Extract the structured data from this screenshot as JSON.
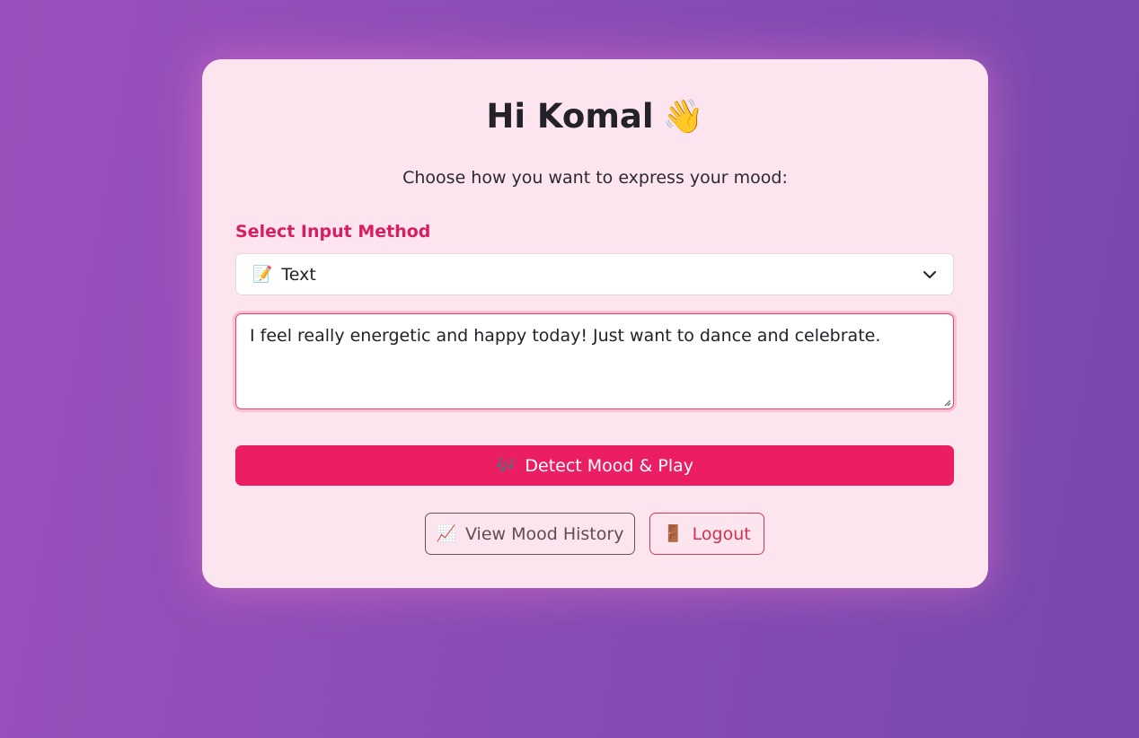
{
  "greeting": {
    "title": "Hi Komal",
    "wave_icon": "👋"
  },
  "subtitle": "Choose how you want to express your mood:",
  "input_method": {
    "label": "Select Input Method",
    "icon": "📝",
    "selected": "Text"
  },
  "mood_text": {
    "value": "I feel really energetic and happy today! Just want to dance and celebrate."
  },
  "actions": {
    "detect": {
      "icon": "🎶",
      "label": "Detect Mood & Play"
    },
    "history": {
      "icon": "📈",
      "label": "View Mood History"
    },
    "logout": {
      "icon": "🚪",
      "label": "Logout"
    }
  },
  "colors": {
    "accent": "#ec1e63",
    "label": "#d81e62",
    "card_bg": "#fde5ef",
    "background_start": "#9b51bd",
    "background_end": "#7848ad"
  }
}
